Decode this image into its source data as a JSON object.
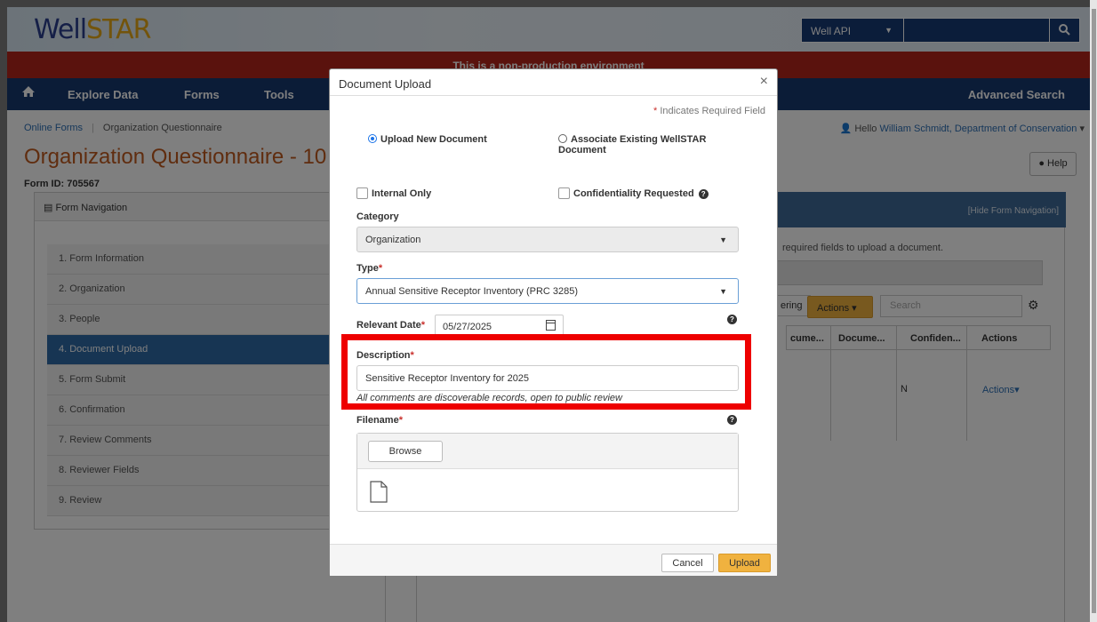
{
  "header": {
    "logo_main": "Well",
    "logo_star": "STAR",
    "search_select": "Well API",
    "icons": {
      "search": "search-icon",
      "home": "home-icon"
    }
  },
  "env_banner": "This is a non-production environment",
  "nav": {
    "items": [
      "Explore Data",
      "Forms",
      "Tools"
    ],
    "advanced_search": "Advanced Search"
  },
  "breadcrumb": {
    "link": "Online Forms",
    "separator": "|",
    "current": "Organization Questionnaire"
  },
  "page_title": "Organization Questionnaire - 10",
  "user": {
    "greeting": "Hello",
    "name": "William Schmidt, Department of Conservation"
  },
  "help_label": "Help",
  "form_id": "Form ID: 705567",
  "form_nav": {
    "title": "Form Navigation",
    "steps": [
      "1. Form Information",
      "2. Organization",
      "3. People",
      "4. Document Upload",
      "5. Form Submit",
      "6. Confirmation",
      "7. Review Comments",
      "8. Reviewer Fields",
      "9. Review"
    ],
    "active_step": "4. Document Upload"
  },
  "right_panel": {
    "hide_nav": "[Hide Form Navigation]",
    "hint": "required fields to upload a document.",
    "filtering": "ering",
    "actions": "Actions",
    "search_placeholder": "Search",
    "columns": [
      "cume...",
      "Docume...",
      "Confiden...",
      "Actions"
    ],
    "row": {
      "confidential": "N",
      "actions": "Actions"
    }
  },
  "modal": {
    "title": "Document Upload",
    "close": "×",
    "required_note": "Indicates Required Field",
    "radio_upload": "Upload New Document",
    "radio_associate_1": "Associate Existing WellSTAR",
    "radio_associate_2": "Document",
    "internal_only": "Internal Only",
    "confidentiality": "Confidentiality Requested",
    "category_label": "Category",
    "category_value": "Organization",
    "type_label": "Type",
    "type_value": "Annual Sensitive Receptor Inventory (PRC 3285)",
    "date_label": "Relevant Date",
    "date_value": "05/27/2025",
    "description_label": "Description",
    "description_value": "Sensitive Receptor Inventory for 2025",
    "description_note": "All comments are discoverable records, open to public review",
    "filename_label": "Filename",
    "browse": "Browse",
    "cancel": "Cancel",
    "upload": "Upload",
    "highlight_color": "#ee0000"
  }
}
